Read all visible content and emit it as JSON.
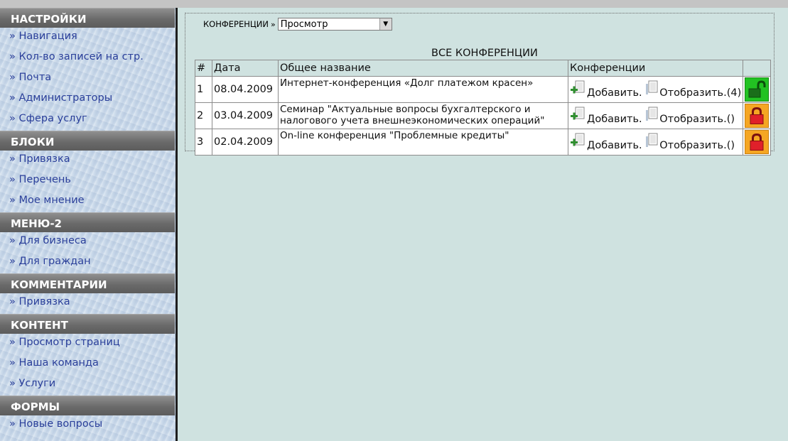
{
  "sidebar": {
    "sections": [
      {
        "title": "НАСТРОЙКИ",
        "items": [
          "» Навигация",
          "» Кол-во записей на стр.",
          "» Почта",
          "» Администраторы",
          "» Сфера услуг"
        ]
      },
      {
        "title": "БЛОКИ",
        "items": [
          "» Привязка",
          "» Перечень",
          "» Мое мнение"
        ]
      },
      {
        "title": "МЕНЮ-2",
        "items": [
          "» Для бизнеса",
          "» Для граждан"
        ]
      },
      {
        "title": "КОММЕНТАРИИ",
        "items": [
          "» Привязка"
        ]
      },
      {
        "title": "КОНТЕНТ",
        "items": [
          "» Просмотр страниц",
          "» Наша команда",
          "» Услуги"
        ]
      },
      {
        "title": "ФОРМЫ",
        "items": [
          "» Новые вопросы"
        ]
      }
    ]
  },
  "main": {
    "legend_label": "КОНФЕРЕНЦИИ",
    "legend_sep": "»",
    "view_select": {
      "selected": "Просмотр"
    },
    "table_title": "ВСЕ КОНФЕРЕНЦИИ",
    "columns": [
      "#",
      "Дата",
      "Общее название",
      "Конференции",
      ""
    ],
    "rows": [
      {
        "num": "1",
        "date": "08.04.2009",
        "title": "Интернет-конференция «Долг платежом красен»",
        "add": "Добавить.",
        "show": "Отобразить.(4)",
        "lock": "unlocked"
      },
      {
        "num": "2",
        "date": "03.04.2009",
        "title": "Семинар \"Актуальные вопросы бухгалтерского и налогового учета внешнеэкономических операций\"",
        "add": "Добавить.",
        "show": "Отобразить.()",
        "lock": "locked"
      },
      {
        "num": "3",
        "date": "02.04.2009",
        "title": "On-line конференция \"Проблемные кредиты\"",
        "add": "Добавить.",
        "show": "Отобразить.()",
        "lock": "locked"
      }
    ]
  },
  "colors": {
    "link": "#2a3f9a",
    "background": "#cfe2e0",
    "header": "#6a6a6a",
    "unlocked": "#22c222",
    "locked": "#e0202a"
  },
  "icons": {
    "add": "add-doc-icon",
    "show": "show-doc-icon",
    "lock_open": "lock-open-icon",
    "lock_closed": "lock-closed-icon"
  }
}
